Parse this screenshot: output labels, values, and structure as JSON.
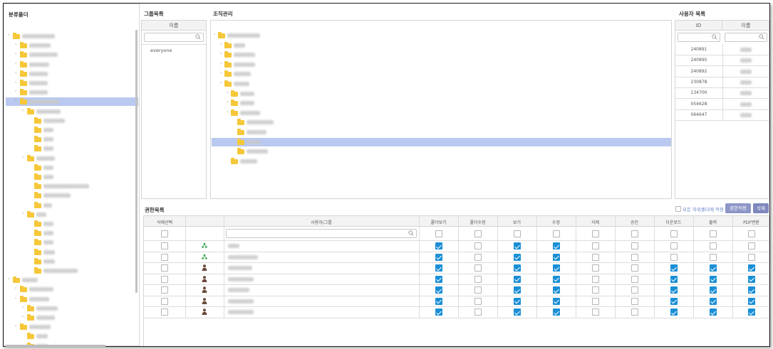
{
  "panels": {
    "category": {
      "title": "분류폴더"
    },
    "group": {
      "title": "그룹목록",
      "column": "이름",
      "items": [
        "everyone"
      ]
    },
    "org": {
      "title": "조직관리"
    },
    "users": {
      "title": "사용자 목록",
      "columns": [
        "ID",
        "이름"
      ],
      "ids": [
        "240891",
        "240895",
        "240892",
        "230878",
        "134700",
        "054628",
        "064647"
      ]
    }
  },
  "permissions": {
    "title": "권한목록",
    "apply_sub_label": "모든 하위폴더에 적용",
    "apply_button": "권한적용",
    "delete_button": "삭제",
    "columns": [
      "삭제선택",
      "",
      "사용자/그룹",
      "폴더보기",
      "폴더수정",
      "보기",
      "수정",
      "삭제",
      "승인",
      "다운로드",
      "출력",
      "PDF변환"
    ],
    "rows": [
      {
        "icon": "group-icon",
        "flags": [
          1,
          0,
          1,
          1,
          0,
          0,
          0,
          0,
          0
        ]
      },
      {
        "icon": "group-icon",
        "flags": [
          1,
          0,
          1,
          1,
          0,
          0,
          0,
          0,
          0
        ]
      },
      {
        "icon": "user-icon",
        "flags": [
          1,
          0,
          1,
          1,
          0,
          0,
          1,
          1,
          1
        ]
      },
      {
        "icon": "user-icon",
        "flags": [
          1,
          0,
          1,
          1,
          0,
          0,
          1,
          1,
          1
        ]
      },
      {
        "icon": "user-icon",
        "flags": [
          1,
          0,
          1,
          1,
          0,
          0,
          1,
          1,
          1
        ]
      },
      {
        "icon": "user-icon",
        "flags": [
          1,
          0,
          1,
          1,
          0,
          0,
          1,
          1,
          1
        ]
      },
      {
        "icon": "user-icon",
        "flags": [
          1,
          0,
          1,
          1,
          0,
          0,
          1,
          1,
          1
        ]
      }
    ]
  },
  "colors": {
    "accent": "#1a8fd6",
    "selection": "#b9c9f0",
    "folder": "#f5c739",
    "button": "#8d96c7"
  }
}
